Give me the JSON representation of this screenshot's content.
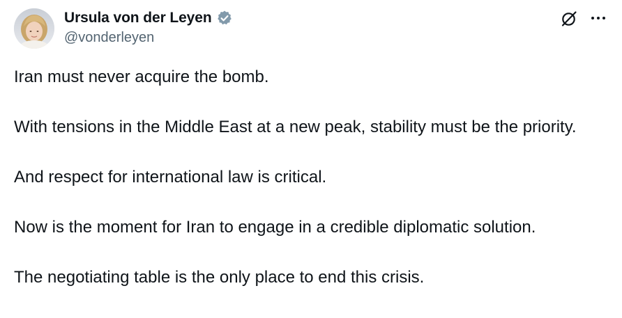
{
  "author": {
    "display_name": "Ursula von der Leyen",
    "handle": "@vonderleyen",
    "verified_icon": "verified-badge-icon",
    "verified_color": "#829aab"
  },
  "icons": {
    "grok": "grok-icon",
    "more": "more-options-icon"
  },
  "tweet": {
    "paragraphs": [
      "Iran must never acquire the bomb.",
      "With tensions in the Middle East at a new peak, stability must be the priority.",
      "And respect for international law is critical.",
      "Now is the moment for Iran to engage in a credible diplomatic solution.",
      "The negotiating table is the only place to end this crisis."
    ]
  },
  "colors": {
    "text": "#0f1419",
    "secondary_text": "#536471",
    "background": "#ffffff"
  }
}
